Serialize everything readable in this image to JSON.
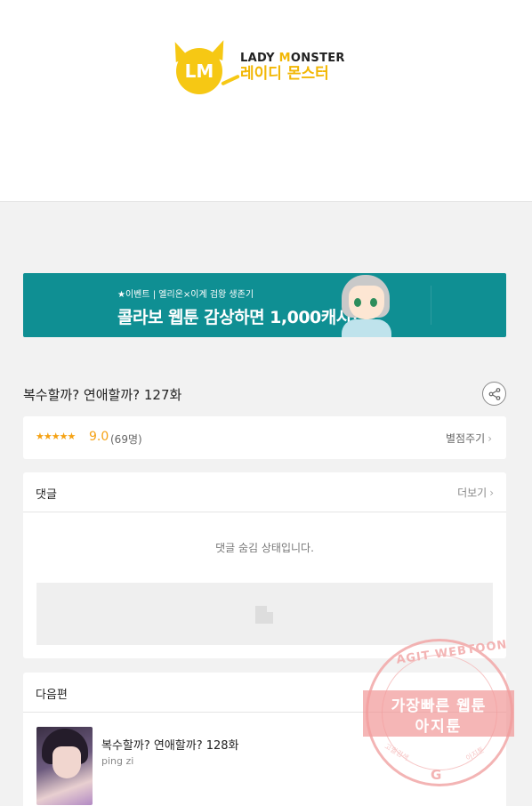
{
  "header": {
    "logo": {
      "mark": "LM",
      "name_en_prefix": "LADY ",
      "name_en_highlight": "M",
      "name_en_rest": "ONSTER",
      "name_ko": "레이디 몬스터"
    }
  },
  "banner": {
    "sub_text": "★이벤트 | 엘리온×이계 검왕 생존기",
    "main_text": "콜라보 웹툰 감상하면 1,000캐시!"
  },
  "episode": {
    "title": "복수할까? 연애할까? 127화",
    "share_icon": "share-icon"
  },
  "rating": {
    "stars": "★★★★★",
    "score": "9.0",
    "count": "(69명)",
    "rate_link": "별점주기",
    "chevron": "›"
  },
  "comments": {
    "title": "댓글",
    "more_link": "더보기",
    "chevron": "›",
    "hidden_message": "댓글 숨김 상태입니다."
  },
  "next": {
    "title": "다음편",
    "item": {
      "title": "복수할까? 연애할까? 128화",
      "author": "ping zi"
    }
  },
  "watermark": {
    "arc_text": "AGIT WEBTOON",
    "line1": "가장빠른 웹툰",
    "line2": "아지툰",
    "bottom_left": "고퀄검색",
    "bottom_right": "아지툰",
    "g_mark": "G"
  },
  "colors": {
    "accent": "#f5a214",
    "banner_bg": "#0f8f93",
    "logo_yellow": "#f6c814",
    "watermark": "#f08c8c"
  }
}
